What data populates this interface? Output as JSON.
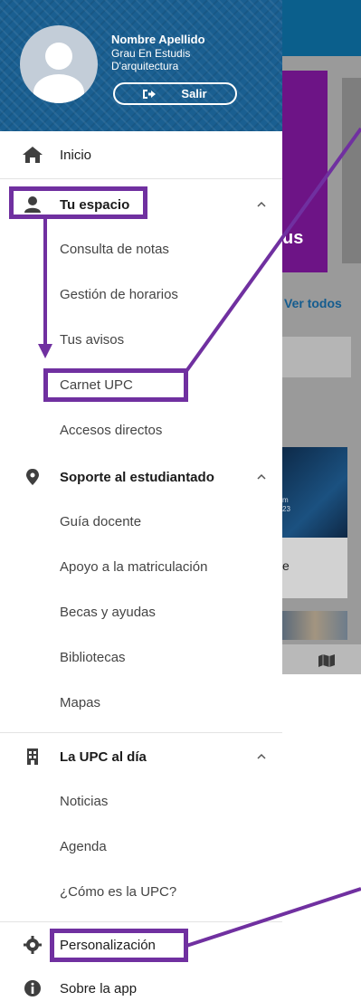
{
  "background": {
    "tile_text": "us",
    "link_text": "Ver todos",
    "card_text_line1": "m",
    "card_text_line2": "23",
    "card2_text": "e",
    "map_icon": "map-icon"
  },
  "header": {
    "user_name": "Nombre Apellido",
    "degree_line1": "Grau En Estudis",
    "degree_line2": "D'arquitectura",
    "logout_label": "Salir",
    "logout_icon": "logout-icon",
    "avatar_icon": "user-avatar-icon"
  },
  "menu": {
    "inicio": {
      "label": "Inicio",
      "icon": "home-icon"
    },
    "tu_espacio": {
      "label": "Tu espacio",
      "icon": "person-icon",
      "items": [
        "Consulta de notas",
        "Gestión de horarios",
        "Tus avisos",
        "Carnet UPC",
        "Accesos directos"
      ]
    },
    "soporte": {
      "label": "Soporte al estudiantado",
      "icon": "location-pin-icon",
      "items": [
        "Guía docente",
        "Apoyo a la matriculación",
        "Becas y ayudas",
        "Bibliotecas",
        "Mapas"
      ]
    },
    "upc_dia": {
      "label": "La UPC al día",
      "icon": "building-icon",
      "items": [
        "Noticias",
        "Agenda",
        "¿Cómo es la UPC?"
      ]
    },
    "personalizacion": {
      "label": "Personalización",
      "icon": "gear-icon"
    },
    "sobre_app": {
      "label": "Sobre la app",
      "icon": "info-icon"
    }
  },
  "colors": {
    "header_blue": "#1a5f91",
    "annotation_purple": "#7030a0",
    "bg_topbar": "#0b5f8c",
    "bg_tile_purple": "#6d1486"
  }
}
